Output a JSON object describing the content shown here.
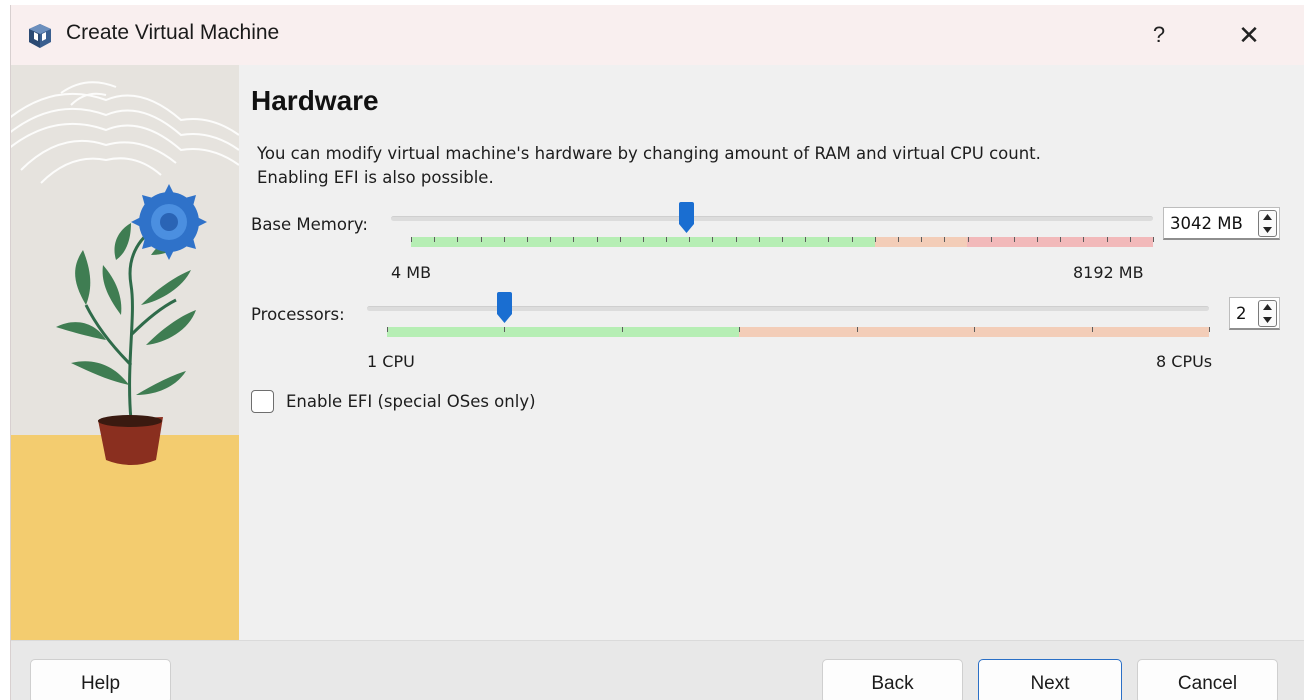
{
  "window": {
    "title": "Create Virtual Machine",
    "help_glyph": "?",
    "close_glyph": "✕",
    "app_icon": "virtualbox-icon"
  },
  "page": {
    "title": "Hardware",
    "description_line1": "You can modify virtual machine's hardware by changing amount of RAM and virtual CPU count.",
    "description_line2": "Enabling EFI is also possible."
  },
  "memory": {
    "label": "Base Memory:",
    "value": "3042 MB",
    "min_label": "4 MB",
    "max_label": "8192 MB",
    "min": 4,
    "max": 8192,
    "current": 3042,
    "zones": {
      "safe_until": 5120,
      "warn_until": 6144
    }
  },
  "processors": {
    "label": "Processors:",
    "value": "2",
    "min_label": "1 CPU",
    "max_label": "8 CPUs",
    "min": 1,
    "max": 8,
    "current": 2,
    "zones": {
      "safe_until": 4
    }
  },
  "efi": {
    "label": "Enable EFI (special OSes only)",
    "checked": false
  },
  "buttons": {
    "help": "Help",
    "back": "Back",
    "next": "Next",
    "cancel": "Cancel"
  },
  "colors": {
    "safe": "#b6eeb4",
    "warn": "#f3cdb8",
    "danger": "#f2b9ba",
    "accent": "#1a6ed1"
  }
}
